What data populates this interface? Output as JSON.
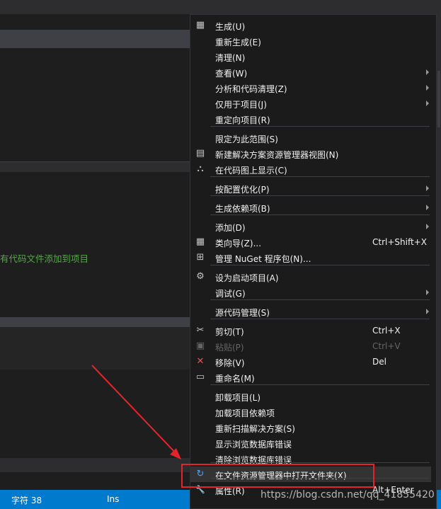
{
  "editor": {
    "hint_text": "有代码文件添加到项目"
  },
  "status_bar": {
    "char": "字符 38",
    "mode": "Ins"
  },
  "context_menu": {
    "items": [
      {
        "label": "生成(U)",
        "icon": "build-icon"
      },
      {
        "label": "重新生成(E)"
      },
      {
        "label": "清理(N)"
      },
      {
        "label": "查看(W)",
        "submenu": true
      },
      {
        "label": "分析和代码清理(Z)",
        "submenu": true
      },
      {
        "label": "仅用于项目(J)",
        "submenu": true
      },
      {
        "label": "重定向项目(R)"
      },
      {
        "label": "限定为此范围(S)"
      },
      {
        "label": "新建解决方案资源管理器视图(N)",
        "icon": "new-view-icon"
      },
      {
        "label": "在代码图上显示(C)",
        "icon": "code-map-icon"
      },
      {
        "label": "按配置优化(P)",
        "submenu": true
      },
      {
        "label": "生成依赖项(B)",
        "submenu": true
      },
      {
        "label": "添加(D)",
        "submenu": true
      },
      {
        "label": "类向导(Z)...",
        "shortcut": "Ctrl+Shift+X",
        "icon": "class-wizard-icon"
      },
      {
        "label": "管理 NuGet 程序包(N)...",
        "icon": "nuget-icon"
      },
      {
        "label": "设为启动项目(A)",
        "icon": "gear-icon"
      },
      {
        "label": "调试(G)",
        "submenu": true
      },
      {
        "label": "源代码管理(S)",
        "submenu": true
      },
      {
        "label": "剪切(T)",
        "shortcut": "Ctrl+X",
        "icon": "scissors-icon"
      },
      {
        "label": "粘贴(P)",
        "shortcut": "Ctrl+V",
        "icon": "paste-icon",
        "disabled": true
      },
      {
        "label": "移除(V)",
        "shortcut": "Del",
        "icon": "remove-icon"
      },
      {
        "label": "重命名(M)",
        "icon": "rename-icon"
      },
      {
        "label": "卸载项目(L)"
      },
      {
        "label": "加载项目依赖项"
      },
      {
        "label": "重新扫描解决方案(S)"
      },
      {
        "label": "显示浏览数据库错误"
      },
      {
        "label": "清除浏览数据库错误"
      },
      {
        "label": "在文件资源管理器中打开文件夹(X)",
        "icon": "open-folder-refresh-icon",
        "highlighted": true
      },
      {
        "label": "属性(R)",
        "shortcut": "Alt+Enter",
        "icon": "wrench-icon"
      }
    ]
  },
  "watermark": "https://blog.csdn.net/qq_41855420",
  "colors": {
    "annotation": "#e0262c",
    "status_bar": "#007acc",
    "menu_bg": "#1b1b1c"
  }
}
